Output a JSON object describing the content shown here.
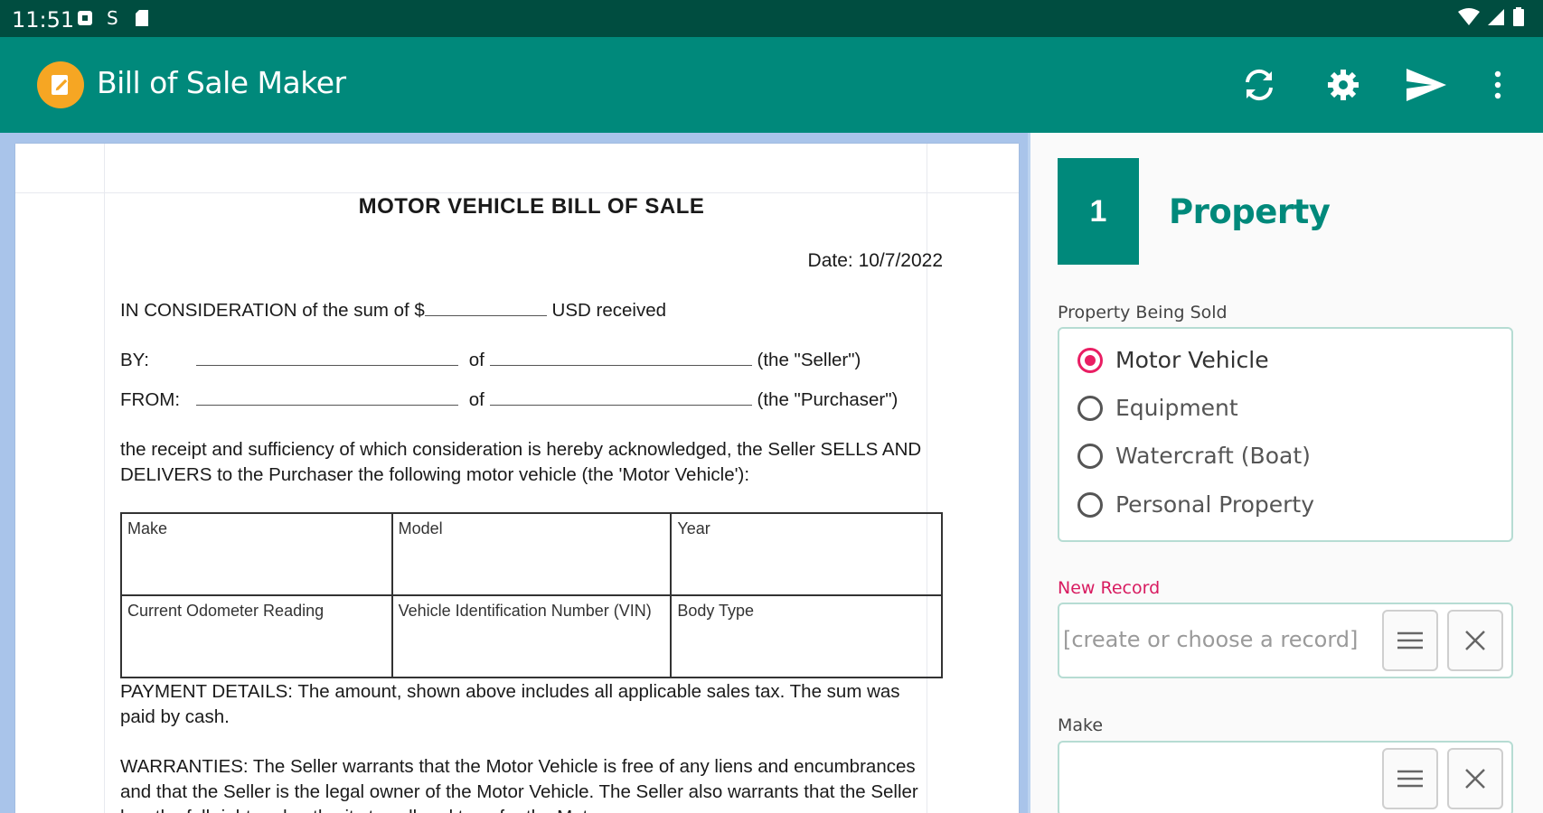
{
  "status_bar": {
    "time": "11:51"
  },
  "app_bar": {
    "title": "Bill of Sale Maker"
  },
  "document": {
    "heading": "MOTOR VEHICLE BILL OF SALE",
    "date": "Date: 10/7/2022",
    "consideration_prefix": "IN CONSIDERATION of the sum of $",
    "consideration_suffix": "USD received",
    "by_label": "BY:",
    "from_label": "FROM:",
    "of_label": "of",
    "seller_label": "(the \"Seller\")",
    "purchaser_label": "(the \"Purchaser\")",
    "receipt_text": "the receipt and sufficiency of which consideration is hereby acknowledged, the Seller SELLS AND DELIVERS to the Purchaser the following motor vehicle (the 'Motor Vehicle'):",
    "table": [
      [
        "Make",
        "Model",
        "Year"
      ],
      [
        "Current Odometer Reading",
        "Vehicle Identification Number (VIN)",
        "Body Type"
      ]
    ],
    "payment_text": "PAYMENT DETAILS: The amount, shown above includes all applicable sales tax. The sum was paid by cash.",
    "warranties_text": "WARRANTIES: The Seller warrants that the Motor Vehicle is free of any liens and encumbrances and that the Seller is the legal owner of the Motor Vehicle. The Seller also warrants that the Seller has the full right and authority to sell and transfer the Motor"
  },
  "form": {
    "step_number": "1",
    "step_title": "Property",
    "property_label": "Property Being Sold",
    "property_options": [
      "Motor Vehicle",
      "Equipment",
      "Watercraft (Boat)",
      "Personal Property"
    ],
    "selected_option": "Motor Vehicle",
    "record_label": "New Record",
    "record_placeholder": "[create or choose a record]",
    "make_label": "Make"
  },
  "colors": {
    "status_bar": "#004d40",
    "app_bar": "#00897b",
    "accent": "#e91e63",
    "logo": "#f6a623"
  }
}
